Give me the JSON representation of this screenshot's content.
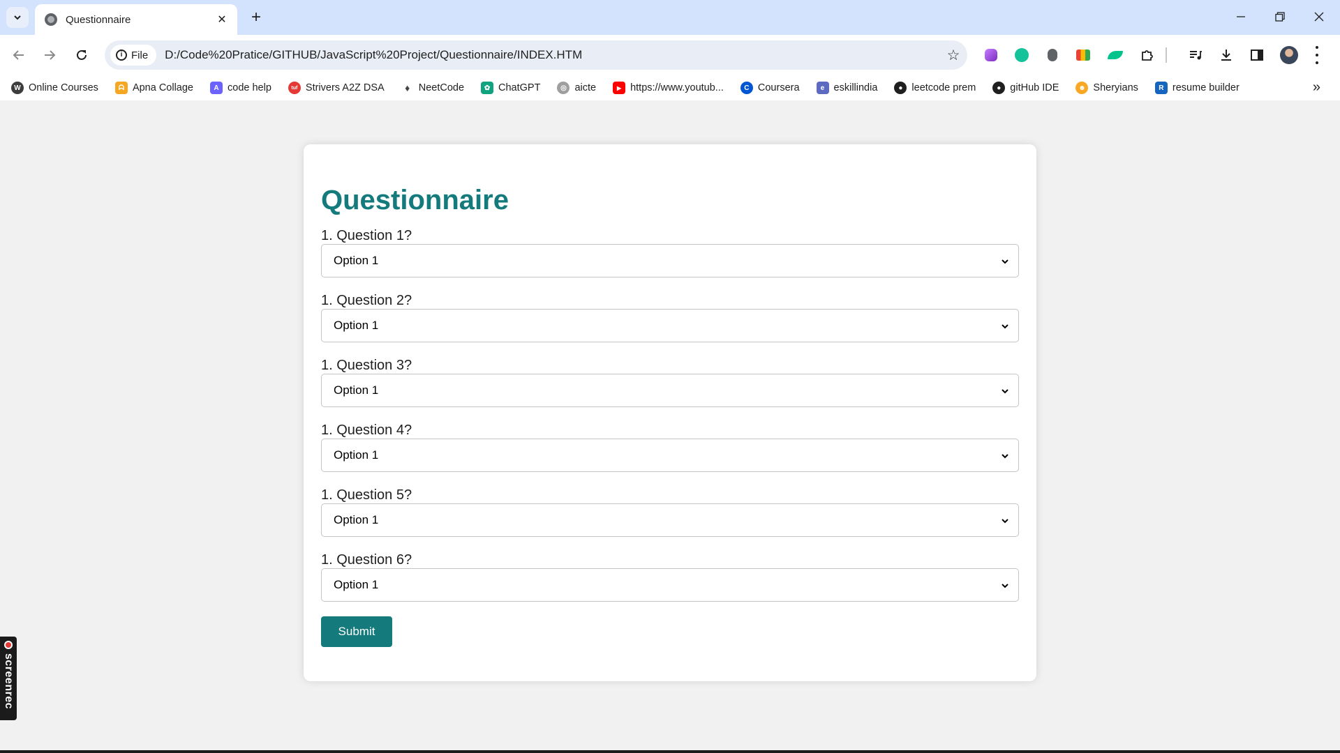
{
  "browser": {
    "tab_title": "Questionnaire",
    "tab_close": "✕",
    "new_tab": "+",
    "omnibox_chip": "File",
    "url": "D:/Code%20Pratice/GITHUB/JavaScript%20Project/Questionnaire/INDEX.HTM",
    "star": "☆"
  },
  "bookmarks": [
    {
      "label": "Online Courses",
      "icon": "wordpress-icon",
      "color": "#3c3c3c",
      "glyph": "W"
    },
    {
      "label": "Apna Collage",
      "icon": "apna-icon",
      "color": "#f5a623",
      "glyph": "ᗣ"
    },
    {
      "label": "code help",
      "icon": "codehelp-icon",
      "color": "#6c63ff",
      "glyph": "A"
    },
    {
      "label": "Strivers A2Z DSA",
      "icon": "tuf-icon",
      "color": "#e53935",
      "glyph": "tuf"
    },
    {
      "label": "NeetCode",
      "icon": "rocket-icon",
      "color": "#444444",
      "glyph": "♦"
    },
    {
      "label": "ChatGPT",
      "icon": "chatgpt-icon",
      "color": "#10a37f",
      "glyph": "✿"
    },
    {
      "label": "aicte",
      "icon": "aicte-icon",
      "color": "#9e9e9e",
      "glyph": "◎"
    },
    {
      "label": "https://www.youtub...",
      "icon": "youtube-icon",
      "color": "#ff0000",
      "glyph": "▶"
    },
    {
      "label": "Coursera",
      "icon": "coursera-icon",
      "color": "#0056d2",
      "glyph": "C"
    },
    {
      "label": "eskillindia",
      "icon": "eskill-icon",
      "color": "#5c6bc0",
      "glyph": "e"
    },
    {
      "label": "leetcode prem",
      "icon": "github-icon",
      "color": "#1f1f1f",
      "glyph": "●"
    },
    {
      "label": "gitHub IDE",
      "icon": "github-icon",
      "color": "#1f1f1f",
      "glyph": "●"
    },
    {
      "label": "Sheryians",
      "icon": "sheryians-icon",
      "color": "#f9a825",
      "glyph": "☻"
    },
    {
      "label": "resume builder",
      "icon": "resume-icon",
      "color": "#1565c0",
      "glyph": "R"
    }
  ],
  "page": {
    "heading": "Questionnaire",
    "questions": [
      {
        "label": "1. Question 1?",
        "selected": "Option 1"
      },
      {
        "label": "1. Question 2?",
        "selected": "Option 1"
      },
      {
        "label": "1. Question 3?",
        "selected": "Option 1"
      },
      {
        "label": "1. Question 4?",
        "selected": "Option 1"
      },
      {
        "label": "1. Question 5?",
        "selected": "Option 1"
      },
      {
        "label": "1. Question 6?",
        "selected": "Option 1"
      }
    ],
    "submit_label": "Submit"
  },
  "overlay": {
    "screenrec_label": "screenrec"
  },
  "colors": {
    "accent": "#147a7c",
    "tabstrip": "#d3e3fd",
    "page_bg": "#f1f1f1"
  }
}
